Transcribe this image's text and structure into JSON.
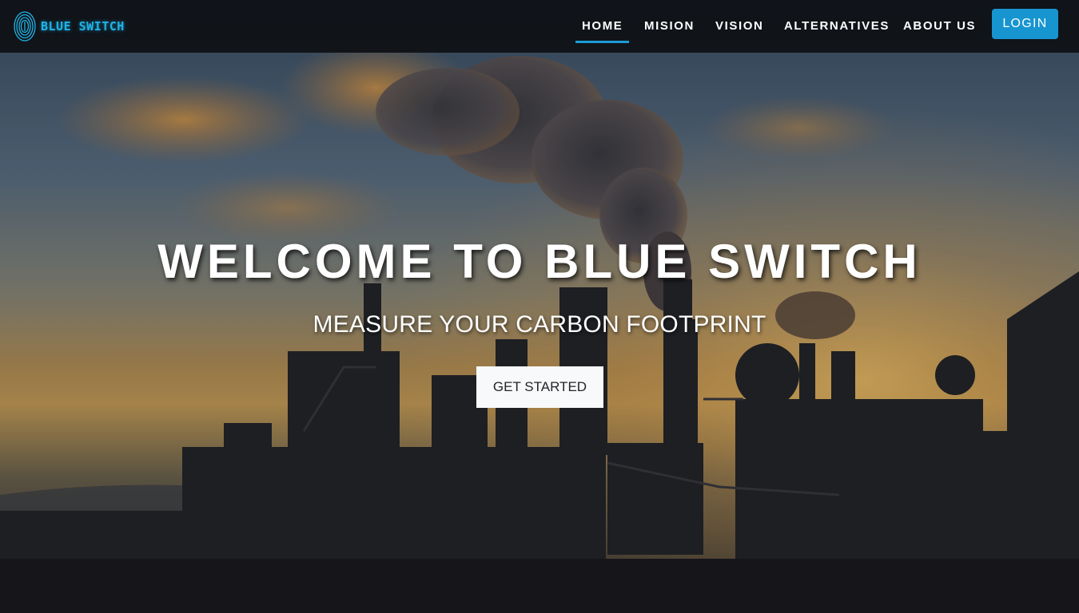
{
  "brand": {
    "name": "BLUE SWITCH",
    "logo_icon": "fingerprint-icon",
    "color": "#1fb3e8"
  },
  "nav": {
    "items": [
      {
        "label": "HOME",
        "active": true
      },
      {
        "label": "MISION",
        "active": false
      },
      {
        "label": "VISION",
        "active": false
      },
      {
        "label": "ALTERNATIVES",
        "active": false
      },
      {
        "label": "ABOUT US",
        "active": false
      }
    ],
    "login_label": "LOGIN",
    "accent_color": "#1795d0"
  },
  "hero": {
    "title": "WELCOME TO BLUE SWITCH",
    "subtitle": "MEASURE YOUR CARBON FOOTPRINT",
    "cta_label": "GET STARTED",
    "background": "industrial-factory-smoke-sunset-photo"
  }
}
